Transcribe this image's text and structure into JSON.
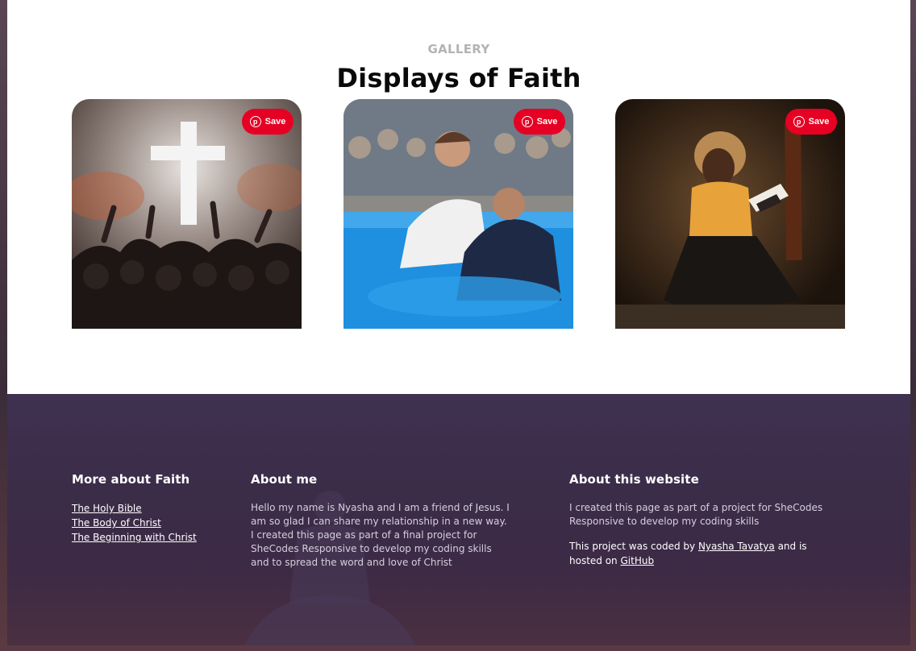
{
  "gallery": {
    "eyebrow": "GALLERY",
    "title": "Displays of Faith",
    "cards": [
      {
        "icon": "pinterest-icon",
        "save_label": "Save",
        "image": "worship-cross-photo"
      },
      {
        "icon": "pinterest-icon",
        "save_label": "Save",
        "image": "baptism-photo"
      },
      {
        "icon": "pinterest-icon",
        "save_label": "Save",
        "image": "woman-reading-bible-photo"
      }
    ],
    "save_color": "#e60023"
  },
  "footer": {
    "col1": {
      "heading": "More about Faith",
      "links": [
        "The Holy Bible",
        "The Body of Christ",
        "The Beginning with Christ"
      ]
    },
    "col2": {
      "heading": "About me",
      "lines": [
        "Hello my name is Nyasha and I am a friend of Jesus. I",
        "am so glad I can share my relationship in a new way.",
        "I created this page as part of a final project for",
        "SheCodes Responsive to develop my coding skills",
        "and to spread the word and love of Christ"
      ]
    },
    "col3": {
      "heading": "About this website",
      "lines": [
        "I created this page as part of a project for SheCodes",
        "Responsive to develop my coding skills"
      ],
      "coded_prefix": "This project was coded by",
      "author_link": "Nyasha Tavatya",
      "coded_middle": "and is",
      "hosted_prefix": "hosted on",
      "github_link": "GitHub"
    }
  }
}
